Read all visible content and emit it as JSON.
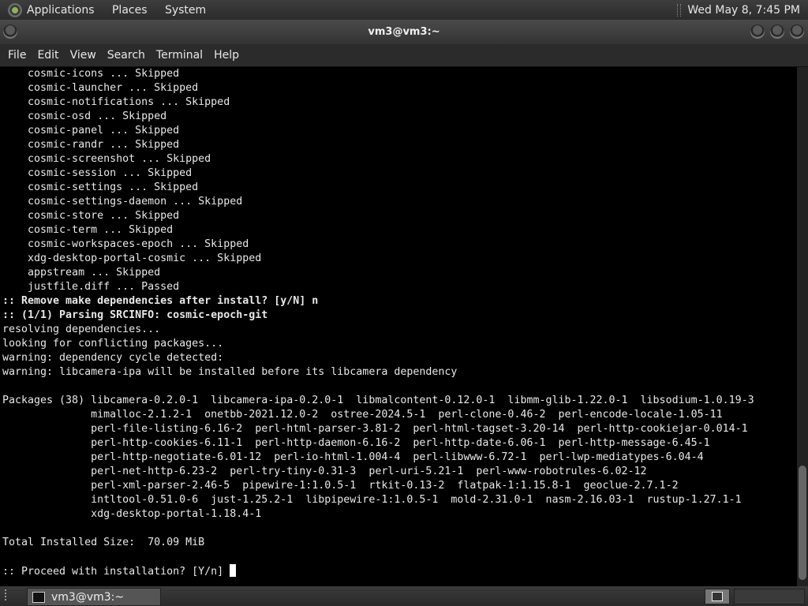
{
  "top_panel": {
    "menus": [
      "Applications",
      "Places",
      "System"
    ],
    "clock": "Wed May  8,  7:45 PM"
  },
  "window": {
    "title": "vm3@vm3:~"
  },
  "menubar": [
    "File",
    "Edit",
    "View",
    "Search",
    "Terminal",
    "Help"
  ],
  "terminal": {
    "lines": [
      {
        "text": "    cosmic-icons ... Skipped",
        "bold": false
      },
      {
        "text": "    cosmic-launcher ... Skipped",
        "bold": false
      },
      {
        "text": "    cosmic-notifications ... Skipped",
        "bold": false
      },
      {
        "text": "    cosmic-osd ... Skipped",
        "bold": false
      },
      {
        "text": "    cosmic-panel ... Skipped",
        "bold": false
      },
      {
        "text": "    cosmic-randr ... Skipped",
        "bold": false
      },
      {
        "text": "    cosmic-screenshot ... Skipped",
        "bold": false
      },
      {
        "text": "    cosmic-session ... Skipped",
        "bold": false
      },
      {
        "text": "    cosmic-settings ... Skipped",
        "bold": false
      },
      {
        "text": "    cosmic-settings-daemon ... Skipped",
        "bold": false
      },
      {
        "text": "    cosmic-store ... Skipped",
        "bold": false
      },
      {
        "text": "    cosmic-term ... Skipped",
        "bold": false
      },
      {
        "text": "    cosmic-workspaces-epoch ... Skipped",
        "bold": false
      },
      {
        "text": "    xdg-desktop-portal-cosmic ... Skipped",
        "bold": false
      },
      {
        "text": "    appstream ... Skipped",
        "bold": false
      },
      {
        "text": "    justfile.diff ... Passed",
        "bold": false
      },
      {
        "text": ":: Remove make dependencies after install? [y/N] n",
        "bold": true
      },
      {
        "text": ":: (1/1) Parsing SRCINFO: cosmic-epoch-git",
        "bold": true
      },
      {
        "text": "resolving dependencies...",
        "bold": false
      },
      {
        "text": "looking for conflicting packages...",
        "bold": false
      },
      {
        "text": "warning: dependency cycle detected:",
        "bold": false
      },
      {
        "text": "warning: libcamera-ipa will be installed before its libcamera dependency",
        "bold": false
      },
      {
        "text": "",
        "bold": false
      },
      {
        "text": "Packages (38) libcamera-0.2.0-1  libcamera-ipa-0.2.0-1  libmalcontent-0.12.0-1  libmm-glib-1.22.0-1  libsodium-1.0.19-3",
        "bold": false
      },
      {
        "text": "              mimalloc-2.1.2-1  onetbb-2021.12.0-2  ostree-2024.5-1  perl-clone-0.46-2  perl-encode-locale-1.05-11",
        "bold": false
      },
      {
        "text": "              perl-file-listing-6.16-2  perl-html-parser-3.81-2  perl-html-tagset-3.20-14  perl-http-cookiejar-0.014-1",
        "bold": false
      },
      {
        "text": "              perl-http-cookies-6.11-1  perl-http-daemon-6.16-2  perl-http-date-6.06-1  perl-http-message-6.45-1",
        "bold": false
      },
      {
        "text": "              perl-http-negotiate-6.01-12  perl-io-html-1.004-4  perl-libwww-6.72-1  perl-lwp-mediatypes-6.04-4",
        "bold": false
      },
      {
        "text": "              perl-net-http-6.23-2  perl-try-tiny-0.31-3  perl-uri-5.21-1  perl-www-robotrules-6.02-12",
        "bold": false
      },
      {
        "text": "              perl-xml-parser-2.46-5  pipewire-1:1.0.5-1  rtkit-0.13-2  flatpak-1:1.15.8-1  geoclue-2.7.1-2",
        "bold": false
      },
      {
        "text": "              intltool-0.51.0-6  just-1.25.2-1  libpipewire-1:1.0.5-1  mold-2.31.0-1  nasm-2.16.03-1  rustup-1.27.1-1",
        "bold": false
      },
      {
        "text": "              xdg-desktop-portal-1.18.4-1",
        "bold": false
      },
      {
        "text": "",
        "bold": false
      },
      {
        "text": "Total Installed Size:  70.09 MiB",
        "bold": false
      },
      {
        "text": "",
        "bold": false
      },
      {
        "text": ":: Proceed with installation? [Y/n] ",
        "bold": false,
        "cursor": true
      }
    ]
  },
  "taskbar": {
    "task_label": "vm3@vm3:~"
  }
}
